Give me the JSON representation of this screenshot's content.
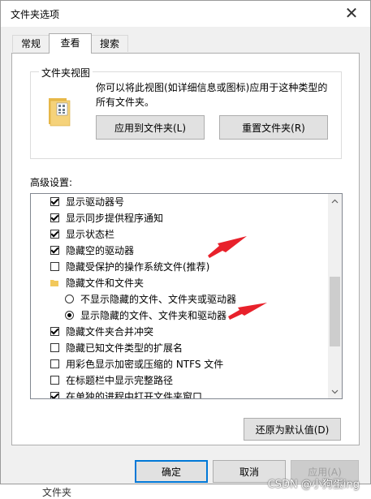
{
  "window": {
    "title": "文件夹选项"
  },
  "tabs": [
    "常规",
    "查看",
    "搜索"
  ],
  "folder_views": {
    "group_title": "文件夹视图",
    "description": "你可以将此视图(如详细信息或图标)应用于这种类型的所有文件夹。",
    "apply_label": "应用到文件夹(L)",
    "reset_label": "重置文件夹(R)"
  },
  "advanced": {
    "label": "高级设置:",
    "items": [
      {
        "type": "checkbox",
        "checked": true,
        "indent": 0,
        "label": "显示驱动器号"
      },
      {
        "type": "checkbox",
        "checked": true,
        "indent": 0,
        "label": "显示同步提供程序通知"
      },
      {
        "type": "checkbox",
        "checked": true,
        "indent": 0,
        "label": "显示状态栏"
      },
      {
        "type": "checkbox",
        "checked": true,
        "indent": 0,
        "label": "隐藏空的驱动器"
      },
      {
        "type": "checkbox",
        "checked": false,
        "indent": 0,
        "label": "隐藏受保护的操作系统文件(推荐)"
      },
      {
        "type": "folder",
        "checked": false,
        "indent": 0,
        "label": "隐藏文件和文件夹"
      },
      {
        "type": "radio",
        "checked": false,
        "indent": 1,
        "label": "不显示隐藏的文件、文件夹或驱动器"
      },
      {
        "type": "radio",
        "checked": true,
        "indent": 1,
        "label": "显示隐藏的文件、文件夹和驱动器"
      },
      {
        "type": "checkbox",
        "checked": true,
        "indent": 0,
        "label": "隐藏文件夹合并冲突"
      },
      {
        "type": "checkbox",
        "checked": false,
        "indent": 0,
        "label": "隐藏已知文件类型的扩展名"
      },
      {
        "type": "checkbox",
        "checked": false,
        "indent": 0,
        "label": "用彩色显示加密或压缩的 NTFS 文件"
      },
      {
        "type": "checkbox",
        "checked": false,
        "indent": 0,
        "label": "在标题栏中显示完整路径"
      },
      {
        "type": "checkbox",
        "checked": true,
        "indent": 0,
        "label": "在单独的进程中打开文件夹窗口"
      }
    ],
    "restore_label": "还原为默认值(D)"
  },
  "footer": {
    "ok_label": "确定",
    "cancel_label": "取消",
    "apply_label": "应用(A)"
  },
  "below_text": "文件夹",
  "watermark": "CSDN @小狗蛋ing",
  "colors": {
    "annotation_arrow": "#e8212b",
    "accent": "#0078d7",
    "folder": "#f2c85b"
  }
}
